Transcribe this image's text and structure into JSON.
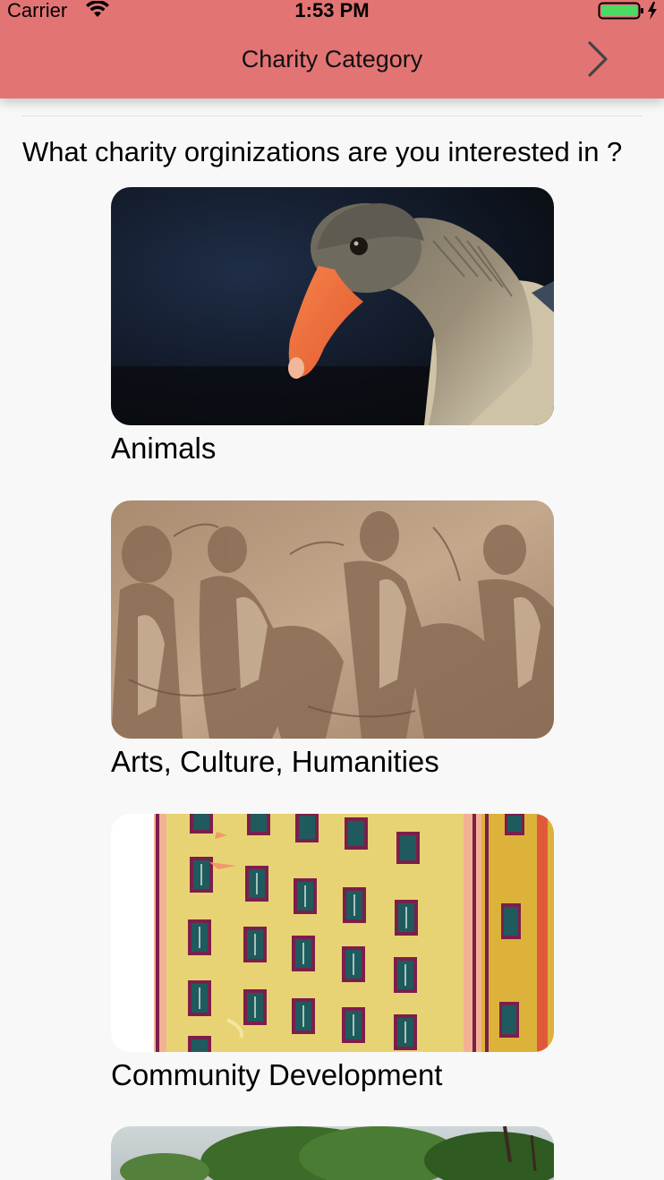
{
  "status_bar": {
    "carrier": "Carrier",
    "time": "1:53 PM",
    "battery_color": "#4cd964"
  },
  "nav": {
    "title": "Charity Category",
    "background_color": "#e37474",
    "next_icon": "chevron-right-icon"
  },
  "prompt": {
    "question": "What charity orginizations are you interested in ?"
  },
  "categories": [
    {
      "label": "Animals",
      "image": "goose-photo"
    },
    {
      "label": "Arts, Culture, Humanities",
      "image": "stone-relief-photo"
    },
    {
      "label": "Community Development",
      "image": "apartment-building-illustration"
    },
    {
      "label": "",
      "image": "trees-photo"
    }
  ]
}
